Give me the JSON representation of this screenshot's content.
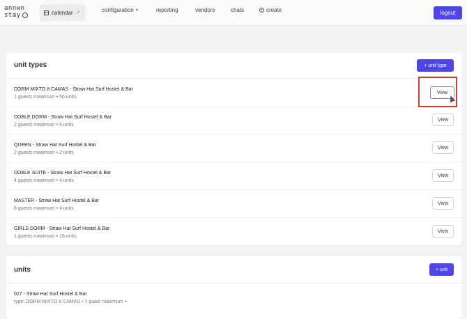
{
  "nav": {
    "logo_line1": "annwn",
    "logo_line2": "stay",
    "calendar": "calendar",
    "configuration": "configuration",
    "reporting": "reporting",
    "vendors": "vendors",
    "chats": "chats",
    "create": "create",
    "logout": "logout"
  },
  "unit_types": {
    "title": "unit types",
    "add_label": "+ unit type",
    "view_label": "View",
    "items": [
      {
        "name": "DORM MIXTO 8 CAMAS - Straw Hat Surf Hostel & Bar",
        "meta": "1 guests maximum • 56 units"
      },
      {
        "name": "DOBLE DORM - Straw Hat Surf Hostel & Bar",
        "meta": "2 guests maximum • 6 units"
      },
      {
        "name": "QUEEN - Straw Hat Surf Hostel & Bar",
        "meta": "2 guests maximum • 2 units"
      },
      {
        "name": "DOBLE SUITE - Straw Hat Surf Hostel & Bar",
        "meta": "4 guests maximum • 4 units"
      },
      {
        "name": "MASTER - Straw Hat Surf Hostel & Bar",
        "meta": "6 guests maximum • 4 units"
      },
      {
        "name": "GIRLS DORM - Straw Hat Surf Hostel & Bar",
        "meta": "1 guests maximum • 16 units"
      }
    ]
  },
  "units": {
    "title": "units",
    "add_label": "+ unit",
    "items": [
      {
        "name": "027 - Straw Hat Surf Hostel & Bar",
        "meta": "type: DORM MIXTO 8 CAMAS • 1 guest maximum •"
      }
    ]
  },
  "colors": {
    "accent": "#4f46e5",
    "highlight": "#d63b2f"
  }
}
